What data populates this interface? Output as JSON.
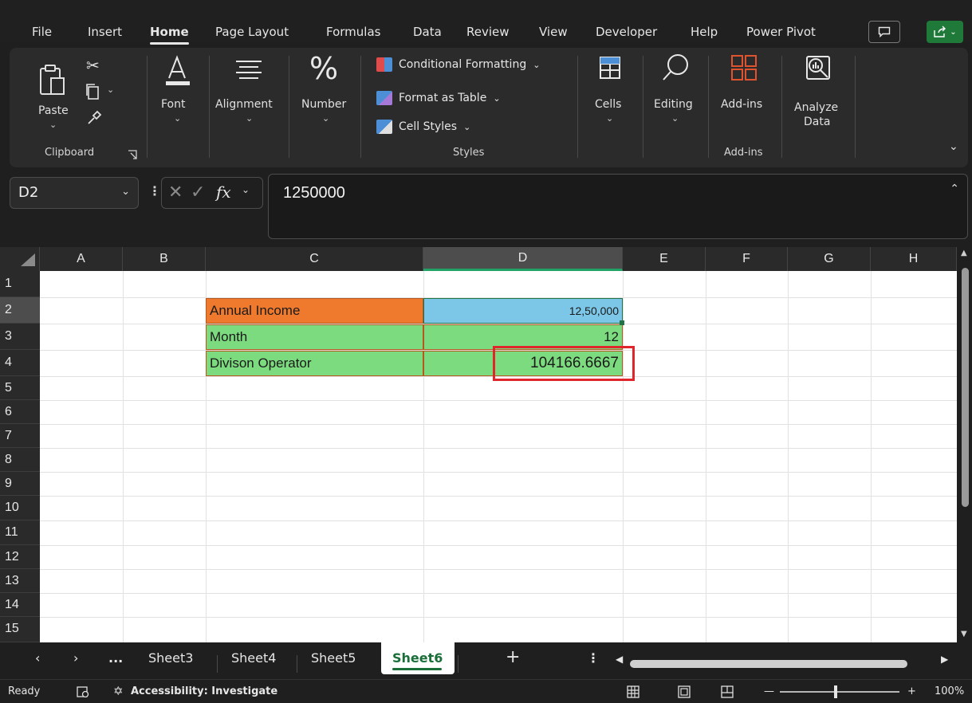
{
  "menu": {
    "tabs": [
      {
        "label": "File"
      },
      {
        "label": "Insert"
      },
      {
        "label": "Home"
      },
      {
        "label": "Page Layout"
      },
      {
        "label": "Formulas"
      },
      {
        "label": "Data"
      },
      {
        "label": "Review"
      },
      {
        "label": "View"
      },
      {
        "label": "Developer"
      },
      {
        "label": "Help"
      },
      {
        "label": "Power Pivot"
      }
    ],
    "active_tab": "Home"
  },
  "ribbon": {
    "paste": "Paste",
    "clipboard": "Clipboard",
    "font": "Font",
    "alignment": "Alignment",
    "number": "Number",
    "conditional_formatting": "Conditional Formatting",
    "format_as_table": "Format as Table",
    "cell_styles": "Cell Styles",
    "styles": "Styles",
    "cells": "Cells",
    "editing": "Editing",
    "addins": "Add-ins",
    "addins_group": "Add-ins",
    "analyze_line1": "Analyze",
    "analyze_line2": "Data"
  },
  "formula_bar": {
    "name_box": "D2",
    "fx_label": "fx",
    "formula": "1250000"
  },
  "grid": {
    "columns": [
      "A",
      "B",
      "C",
      "D",
      "E",
      "F",
      "G",
      "H"
    ],
    "selected_column": "D",
    "rows": [
      "1",
      "2",
      "3",
      "4",
      "5",
      "6",
      "7",
      "8",
      "9",
      "10",
      "11",
      "12",
      "13",
      "14",
      "15"
    ],
    "selected_row": "2",
    "cells": {
      "C2": "Annual Income",
      "D2": "12,50,000",
      "C3": "Month",
      "D3": "12",
      "C4": "Divison Operator",
      "D4": "104166.6667"
    },
    "colors": {
      "orange": "#ef7a2e",
      "blue": "#7cc7e8",
      "green": "#7ddb7f",
      "highlight": "#e0262b"
    }
  },
  "sheets": {
    "tabs": [
      {
        "label": "Sheet3"
      },
      {
        "label": "Sheet4"
      },
      {
        "label": "Sheet5"
      },
      {
        "label": "Sheet6"
      }
    ],
    "active": "Sheet6",
    "more": "..."
  },
  "status": {
    "ready": "Ready",
    "accessibility": "Accessibility: Investigate",
    "zoom": "100%"
  }
}
